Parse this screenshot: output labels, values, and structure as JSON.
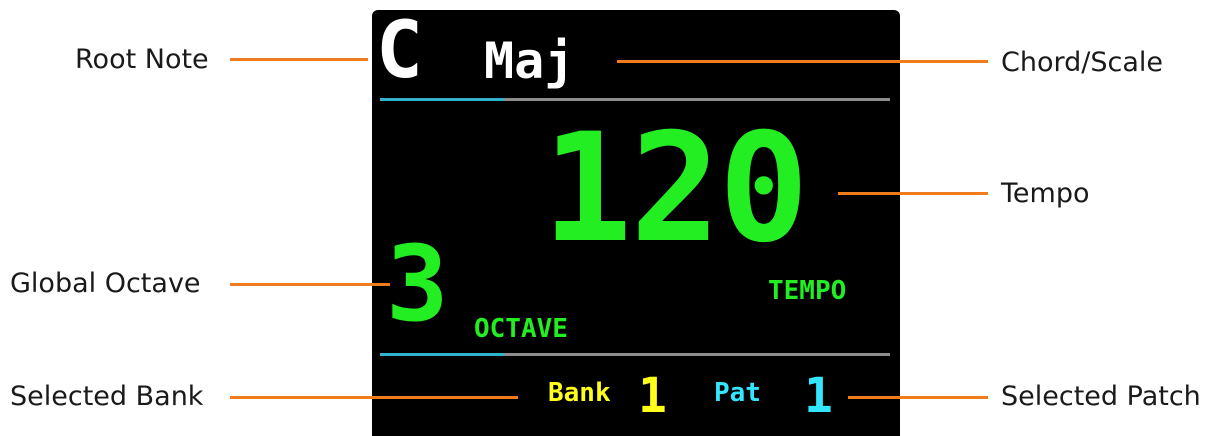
{
  "display": {
    "root_note": "C",
    "chord_scale": "Maj",
    "tempo_value": "120",
    "tempo_label": "TEMPO",
    "octave_value": "3",
    "octave_label": "OCTAVE",
    "bank_label": "Bank",
    "bank_value": "1",
    "patch_label": "Pat",
    "patch_value": "1"
  },
  "callouts": {
    "root_note": "Root Note",
    "chord_scale": "Chord/Scale",
    "tempo": "Tempo",
    "global_octave": "Global Octave",
    "selected_bank": "Selected Bank",
    "selected_patch": "Selected Patch"
  },
  "colors": {
    "screen_background": "#000000",
    "white_text": "#ffffff",
    "green_text": "#22ee22",
    "yellow_text": "#ffff1a",
    "cyan_text": "#33e6ff",
    "leader_orange": "#f07c1b",
    "divider_gray": "#8c8c8c",
    "divider_accent": "#2fb3cf"
  }
}
